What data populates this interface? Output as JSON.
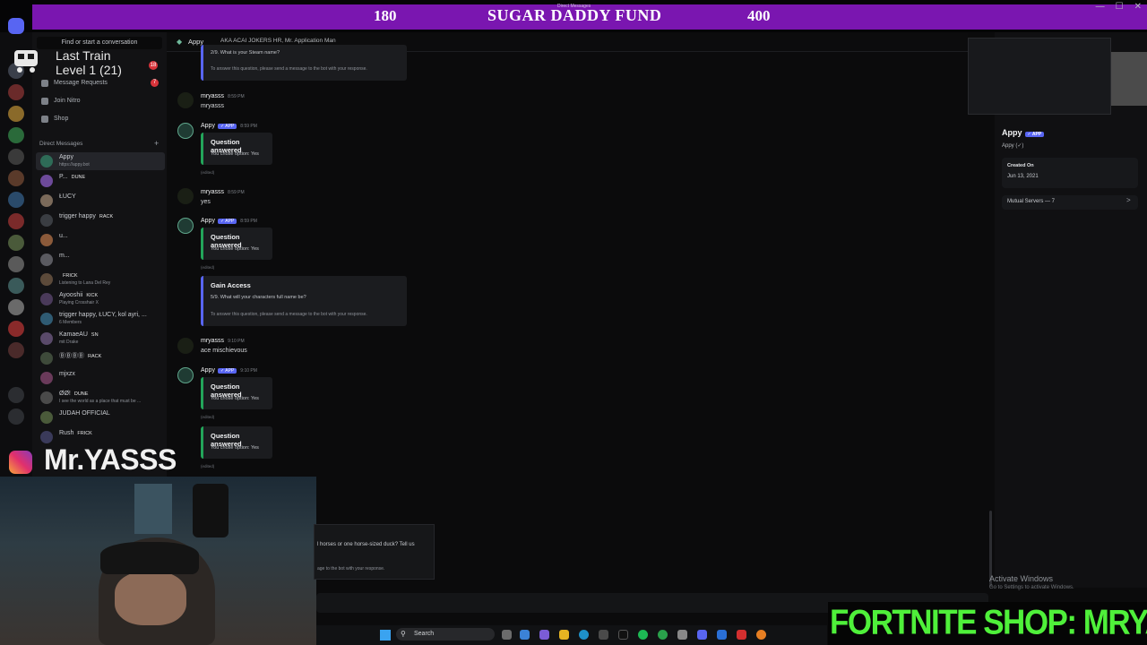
{
  "banner": {
    "left_number": "180",
    "title": "SUGAR DADDY FUND",
    "right_number": "400",
    "center_small": "Direct Messages"
  },
  "overlay": {
    "train_line1": "Last Train",
    "train_line2": "Level 1  (21)",
    "badge": "18",
    "handle": "Mr.YASSS"
  },
  "sidebar": {
    "find_placeholder": "Find or start a conversation",
    "links": [
      "Message Requests",
      "Join Nitro",
      "Shop"
    ],
    "message_requests_badge": "7",
    "dm_header": "Direct Messages",
    "dm_plus": "+",
    "dms": [
      {
        "name": "Appy",
        "sub": "https://appy.bot",
        "tag": "",
        "color": "#2e6b57",
        "active": true
      },
      {
        "name": "P...",
        "sub": "",
        "tag": "DUNE",
        "color": "#6d4a9a",
        "active": false
      },
      {
        "name": "ŁUCY",
        "sub": "",
        "tag": "",
        "color": "#7b6a5a",
        "active": false
      },
      {
        "name": "trigger happy",
        "sub": "",
        "tag": "RACK",
        "color": "#3a3d42",
        "active": false
      },
      {
        "name": "u...",
        "sub": "",
        "tag": "",
        "color": "#8b5a3a",
        "active": false
      },
      {
        "name": "m...",
        "sub": "",
        "tag": "",
        "color": "#5a5a60",
        "active": false
      },
      {
        "name": "",
        "sub": "Listening to Lana Del Rey",
        "tag": "FRICK",
        "color": "#5c4a3a",
        "active": false
      },
      {
        "name": "Ayooshii",
        "sub": "Playing Crosshair X",
        "tag": "KICK",
        "color": "#4a3a5a",
        "active": false
      },
      {
        "name": "trigger happy, ŁUCY, kol ayri, ...",
        "sub": "6 Members",
        "tag": "",
        "color": "#2f5b73",
        "active": false
      },
      {
        "name": "KamaeAU",
        "sub": "mit Drake",
        "tag": "SN",
        "color": "#5a4a6a",
        "active": false
      },
      {
        "name": "ⒷⒷⒷⒷ",
        "sub": "",
        "tag": "RACK",
        "color": "#3e4a3a",
        "active": false
      },
      {
        "name": "mjxzx",
        "sub": "",
        "tag": "",
        "color": "#6a3a5a",
        "active": false
      },
      {
        "name": "ØØ!",
        "sub": "I see the world as a place that must be ...",
        "tag": "DUNE",
        "color": "#4a4a4a",
        "active": false
      },
      {
        "name": "JUDAH OFFICIAL",
        "sub": "",
        "tag": "",
        "color": "#4a5a3a",
        "active": false
      },
      {
        "name": "Rush",
        "sub": "",
        "tag": "FRICK",
        "color": "#3a3a5a",
        "active": false
      }
    ]
  },
  "chat": {
    "header_name": "Appy",
    "header_aka": "AKA   ACAI JOKERS HR, Mr. Application Man",
    "top_embed_line1": "2/9. What is your Steam name?",
    "top_embed_line2": "To answer this question, please send a message to the bot with your response.",
    "messages": [
      {
        "author": "mryasss",
        "time": "8:59 PM",
        "text": "mryasss"
      },
      {
        "author": "Appy",
        "badge": "✓ APP",
        "time": "8:59 PM",
        "embed_title": "Question answered",
        "embed_body": "You chose option:  Yes",
        "edited": "(edited)"
      },
      {
        "author": "mryasss",
        "time": "8:59 PM",
        "text": "yes"
      },
      {
        "author": "Appy",
        "badge": "✓ APP",
        "time": "8:59 PM",
        "embed_title": "Question answered",
        "embed_body": "You chose option:  Yes",
        "edited": "(edited)"
      },
      {
        "gain_title": "Gain Access",
        "gain_line1": "5/9. What will your characters full name be?",
        "gain_line2": "To answer this question, please send a message to the bot with your response."
      },
      {
        "author": "mryasss",
        "time": "9:10 PM",
        "text": "ace mischievous"
      },
      {
        "author": "Appy",
        "badge": "✓ APP",
        "time": "9:10 PM",
        "embed_title": "Question answered",
        "embed_body": "You chose option:  Yes",
        "edited": "(edited)"
      },
      {
        "embed_title": "Question answered",
        "embed_body": "You chose option:  Yes",
        "edited": "(edited)"
      }
    ],
    "popup_line1": "l horses or one horse-sized duck? Tell us",
    "popup_line2": "age to the bot with your response."
  },
  "profile": {
    "name": "Appy",
    "badge": "✓ APP",
    "sub": "Appy (✓)",
    "created_label": "Created On",
    "created_date": "Jun 13, 2021",
    "mutual": "Mutual Servers — 7",
    "chevron": ">"
  },
  "system": {
    "activate_title": "Activate Windows",
    "activate_sub": "Go to Settings to activate Windows.",
    "search_label": "Search"
  },
  "fortnite": {
    "text": "FORTNITE SHOP: MRYAS"
  },
  "colors": {
    "banner_purple": "#7a16b0",
    "fortnite_green": "#4ff03a",
    "discord_blurple": "#5865f2",
    "embed_green": "#23a55a"
  }
}
